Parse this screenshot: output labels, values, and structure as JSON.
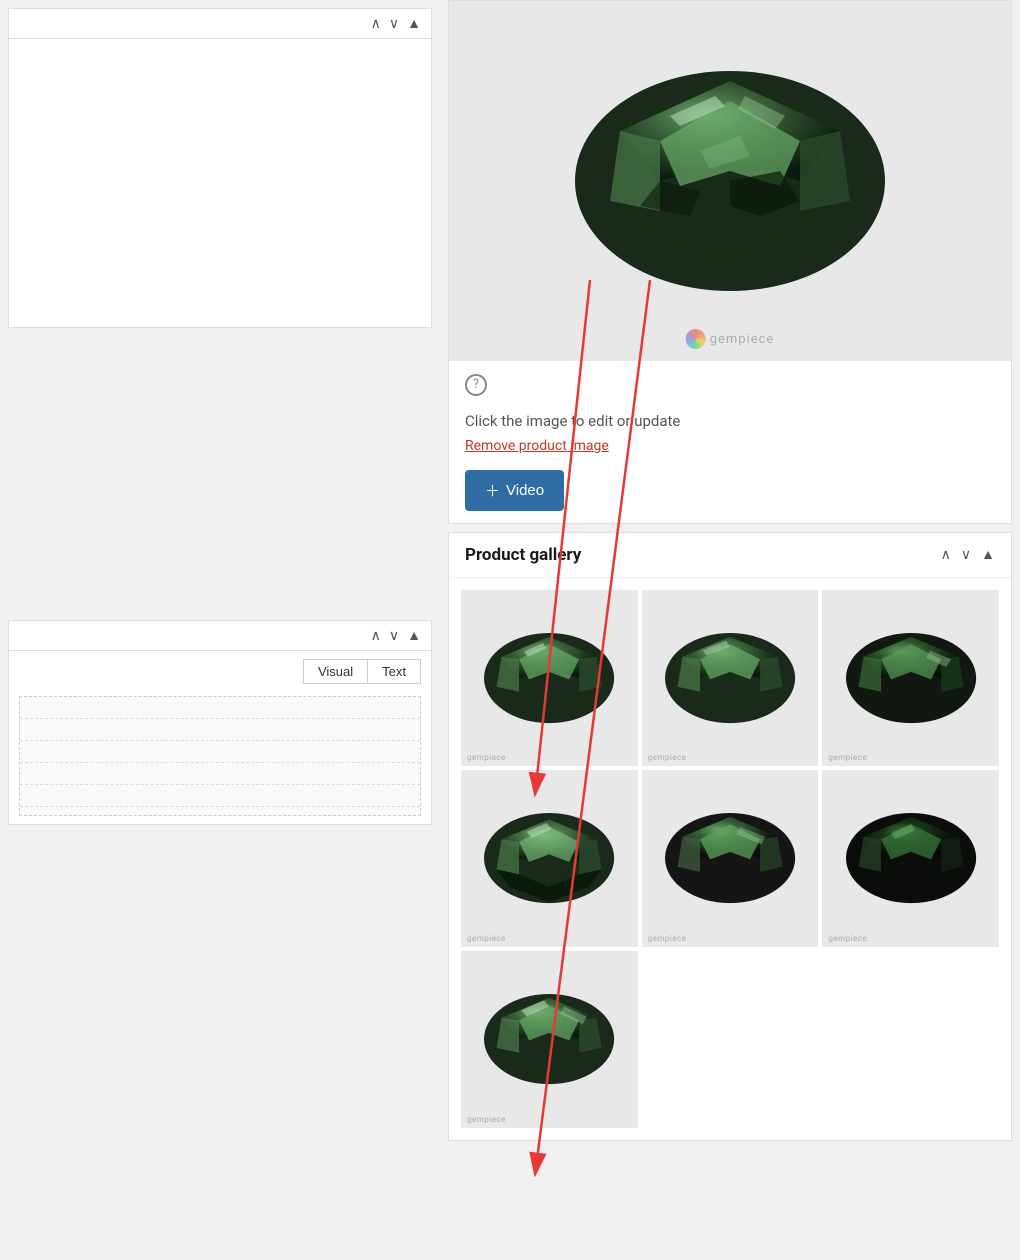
{
  "left_panel": {
    "block1": {
      "toolbar": {
        "up_icon": "▲",
        "down_icon": "▼",
        "arrow_up_icon": "▲"
      }
    },
    "block2": {
      "toolbar": {
        "up_icon": "▲",
        "down_icon": "▼",
        "arrow_up_icon": "▲"
      },
      "tabs": {
        "visual": "Visual",
        "text": "Text"
      }
    }
  },
  "right_panel": {
    "product_image": {
      "help_icon": "?",
      "click_to_edit": "Click the image to edit or update",
      "remove_link": "Remove product image",
      "add_video_button": "+ Video",
      "watermark_text": "gempiece"
    },
    "product_gallery": {
      "title": "Product gallery",
      "toolbar": {
        "up_icon": "▲",
        "down_icon": "▼",
        "arrow_up_icon": "▲"
      },
      "gallery_items": [
        {
          "id": 1,
          "watermark": "gempiece"
        },
        {
          "id": 2,
          "watermark": "gempiece"
        },
        {
          "id": 3,
          "watermark": "gempiece"
        },
        {
          "id": 4,
          "watermark": "gempiece"
        },
        {
          "id": 5,
          "watermark": "gempiece"
        },
        {
          "id": 6,
          "watermark": "gempiece"
        },
        {
          "id": 7,
          "watermark": "gempiece"
        }
      ]
    }
  },
  "colors": {
    "accent_blue": "#2e6da4",
    "remove_red": "#c0392b",
    "arrow_red": "#e53935"
  }
}
